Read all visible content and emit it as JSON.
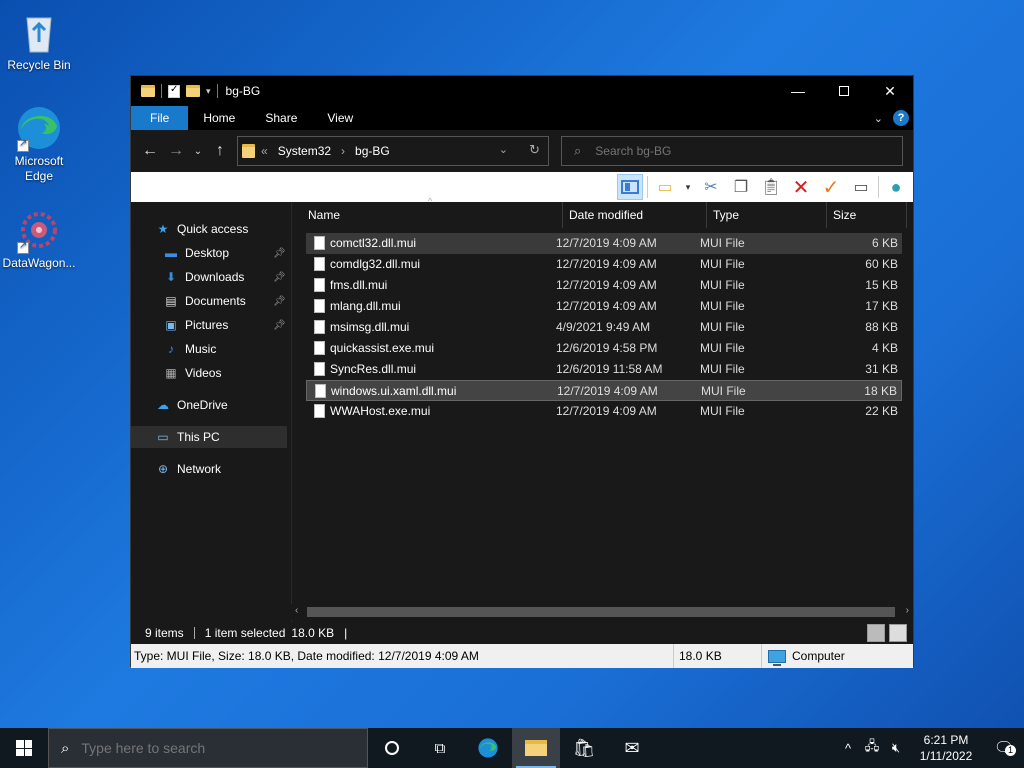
{
  "desktop": {
    "icons": [
      {
        "label": "Recycle Bin"
      },
      {
        "label": "Microsoft Edge"
      },
      {
        "label": "DataWagon..."
      }
    ]
  },
  "window": {
    "title": "bg-BG",
    "ribbon_tabs": [
      "File",
      "Home",
      "Share",
      "View"
    ],
    "breadcrumb": [
      "«",
      "System32",
      "›",
      "bg-BG"
    ],
    "search_placeholder": "Search bg-BG"
  },
  "nav": {
    "quick_access": "Quick access",
    "items": [
      {
        "label": "Desktop",
        "pinned": true
      },
      {
        "label": "Downloads",
        "pinned": true
      },
      {
        "label": "Documents",
        "pinned": true
      },
      {
        "label": "Pictures",
        "pinned": true
      },
      {
        "label": "Music",
        "pinned": false
      },
      {
        "label": "Videos",
        "pinned": false
      }
    ],
    "onedrive": "OneDrive",
    "this_pc": "This PC",
    "network": "Network"
  },
  "columns": {
    "name": "Name",
    "date": "Date modified",
    "type": "Type",
    "size": "Size"
  },
  "files": [
    {
      "name": "comctl32.dll.mui",
      "date": "12/7/2019 4:09 AM",
      "type": "MUI File",
      "size": "6 KB"
    },
    {
      "name": "comdlg32.dll.mui",
      "date": "12/7/2019 4:09 AM",
      "type": "MUI File",
      "size": "60 KB"
    },
    {
      "name": "fms.dll.mui",
      "date": "12/7/2019 4:09 AM",
      "type": "MUI File",
      "size": "15 KB"
    },
    {
      "name": "mlang.dll.mui",
      "date": "12/7/2019 4:09 AM",
      "type": "MUI File",
      "size": "17 KB"
    },
    {
      "name": "msimsg.dll.mui",
      "date": "4/9/2021 9:49 AM",
      "type": "MUI File",
      "size": "88 KB"
    },
    {
      "name": "quickassist.exe.mui",
      "date": "12/6/2019 4:58 PM",
      "type": "MUI File",
      "size": "4 KB"
    },
    {
      "name": "SyncRes.dll.mui",
      "date": "12/6/2019 11:58 AM",
      "type": "MUI File",
      "size": "31 KB"
    },
    {
      "name": "windows.ui.xaml.dll.mui",
      "date": "12/7/2019 4:09 AM",
      "type": "MUI File",
      "size": "18 KB"
    },
    {
      "name": "WWAHost.exe.mui",
      "date": "12/7/2019 4:09 AM",
      "type": "MUI File",
      "size": "22 KB"
    }
  ],
  "status": {
    "items": "9 items",
    "selected": "1 item selected",
    "size": "18.0 KB",
    "pipe": "|"
  },
  "infobar": {
    "details": "Type: MUI File, Size: 18.0 KB, Date modified: 12/7/2019 4:09 AM",
    "size": "18.0 KB",
    "location": "Computer"
  },
  "taskbar": {
    "search_placeholder": "Type here to search",
    "time": "6:21 PM",
    "date": "1/11/2022",
    "notifications": "1"
  },
  "colors": {
    "accent": "#1979ca",
    "window_bg": "#191919",
    "selection": "#444444"
  }
}
